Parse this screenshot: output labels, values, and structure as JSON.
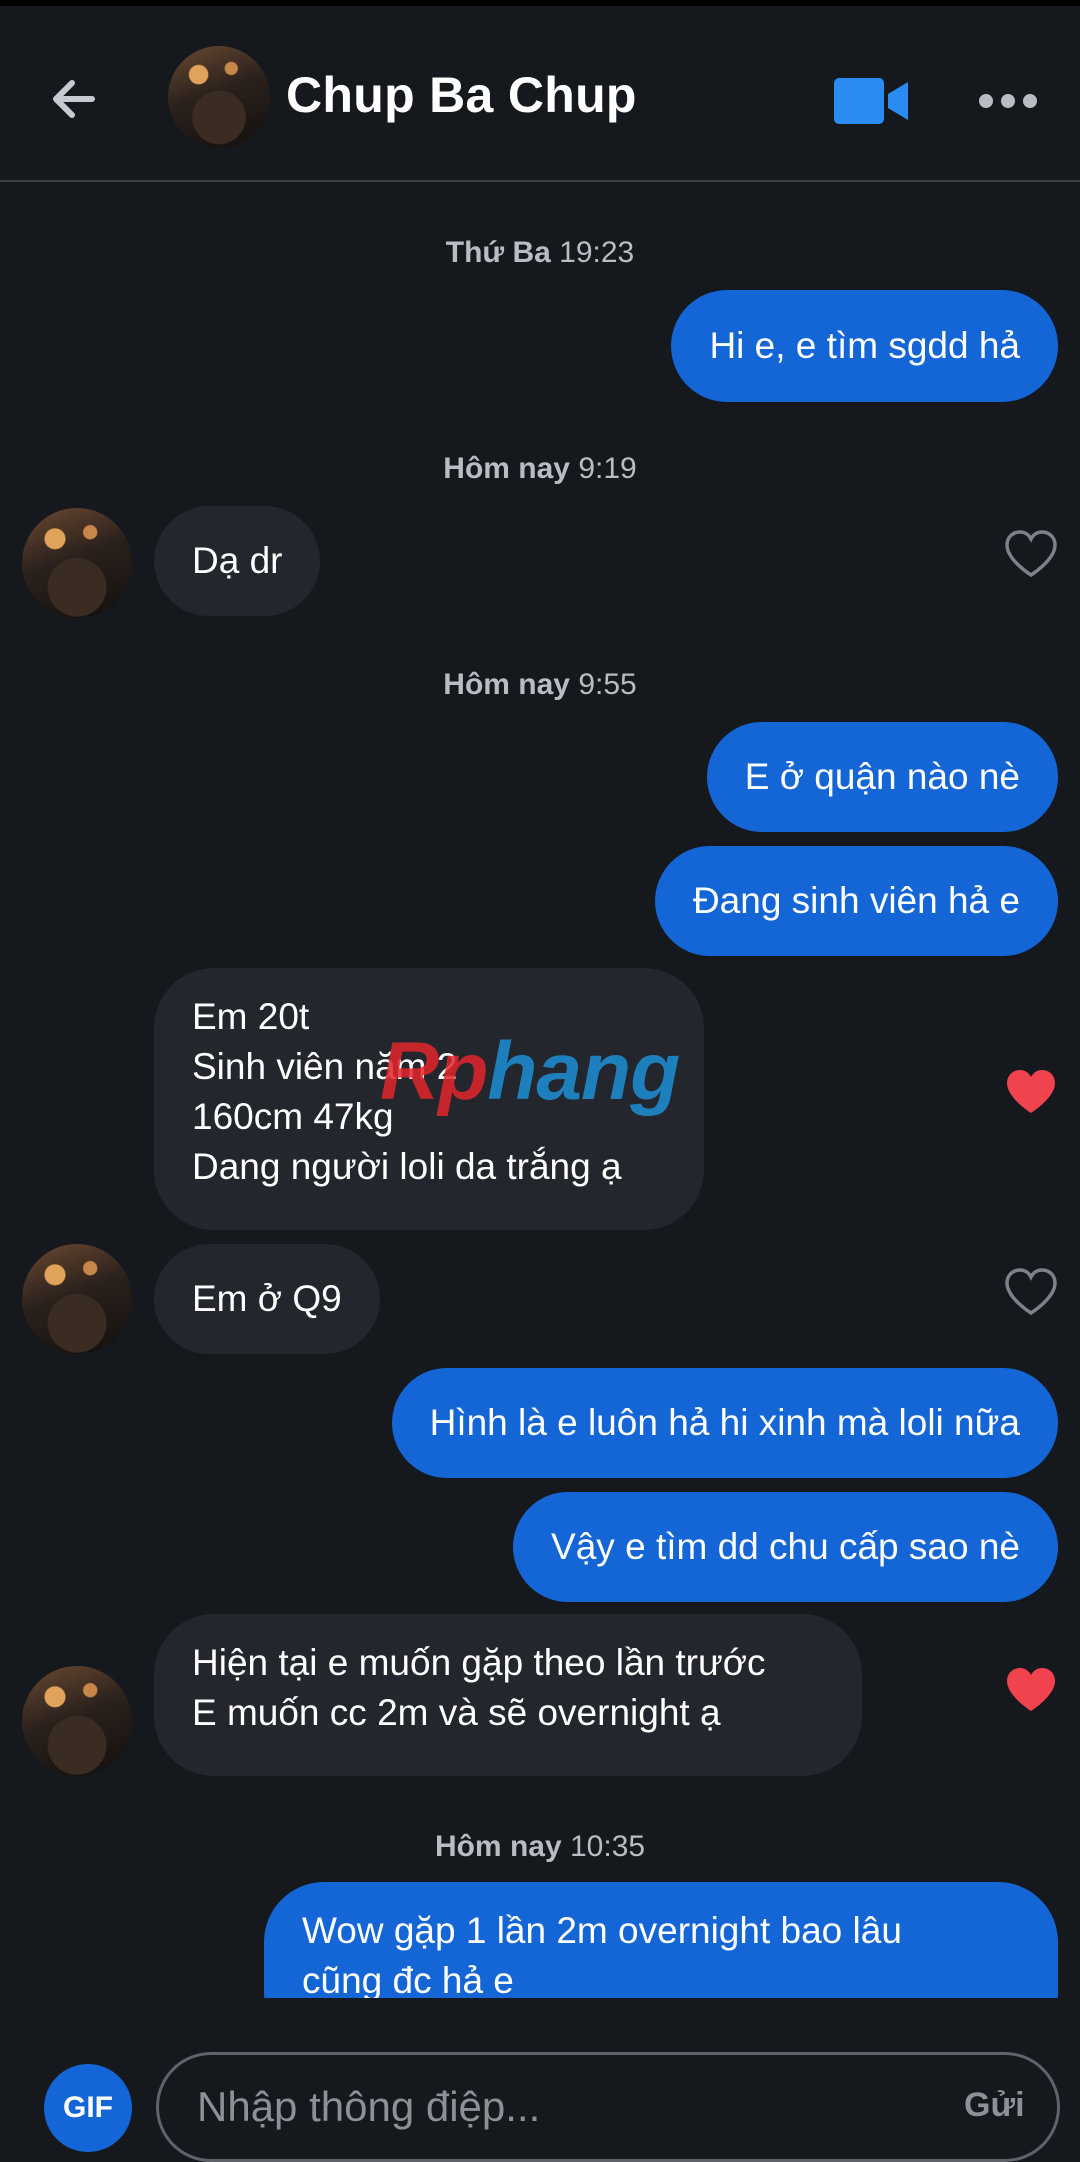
{
  "header": {
    "title": "Chup Ba Chup",
    "back_icon": "arrow-left-icon",
    "video_icon": "video-camera-icon",
    "more_icon": "more-dots-icon"
  },
  "colors": {
    "background": "#15181d",
    "outgoing_bubble": "#1466d6",
    "incoming_bubble": "#23262d",
    "heart_liked": "#f0434e"
  },
  "timestamps": [
    {
      "day": "Thứ Ba",
      "time": "19:23"
    },
    {
      "day": "Hôm nay",
      "time": "9:19"
    },
    {
      "day": "Hôm nay",
      "time": "9:55"
    },
    {
      "day": "Hôm nay",
      "time": "10:35"
    }
  ],
  "messages": [
    {
      "dir": "out",
      "text": "Hi e, e tìm sgdd hả"
    },
    {
      "dir": "in",
      "text": "Dạ dr",
      "liked": false
    },
    {
      "dir": "out",
      "text": "E ở quận nào nè"
    },
    {
      "dir": "out",
      "text": "Đang sinh viên hả e"
    },
    {
      "dir": "in",
      "lines": [
        "Em 20t",
        "Sinh viên năm 2",
        "160cm 47kg",
        "Dang người loli da trắng ạ"
      ],
      "liked": true
    },
    {
      "dir": "in",
      "text": "Em ở Q9",
      "liked": false
    },
    {
      "dir": "out",
      "text": "Hình là e luôn hả hi xinh mà loli nữa"
    },
    {
      "dir": "out",
      "text": "Vậy e tìm dd chu cấp sao nè"
    },
    {
      "dir": "in",
      "lines": [
        "Hiện tại e muốn gặp theo lần trước",
        "E muốn cc 2m và sẽ overnight ạ"
      ],
      "liked": true
    },
    {
      "dir": "out",
      "lines": [
        "Wow gặp 1 lần 2m overnight bao lâu",
        "cũng đc hả e"
      ]
    }
  ],
  "watermark": {
    "part1": "Rp",
    "part2": "hang"
  },
  "composer": {
    "gif_label": "GIF",
    "placeholder": "Nhập thông điệp...",
    "send_label": "Gửi"
  }
}
